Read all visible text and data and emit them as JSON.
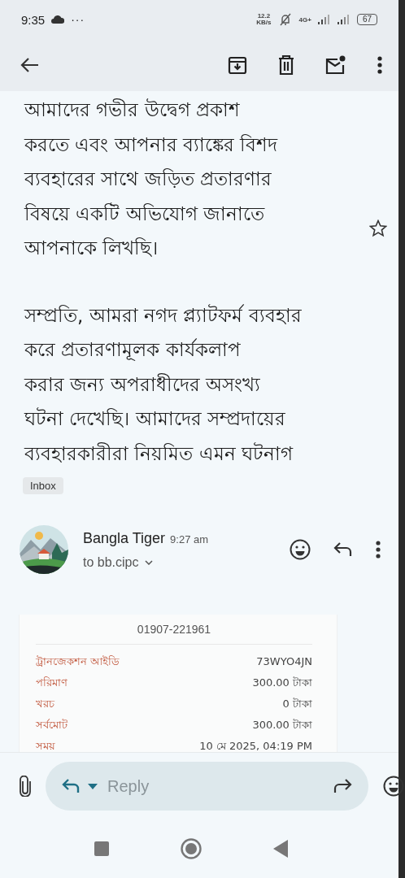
{
  "status_bar": {
    "time": "9:35",
    "more": "···",
    "speed": "12.2",
    "speed_unit": "KB/s",
    "network": "4G+",
    "battery": "67"
  },
  "body": {
    "paragraphs": [
      "আমাদের গভীর উদ্বেগ প্রকাশ\nকরতে এবং আপনার ব্যাঙ্কের বিশদ\nব্যবহারের সাথে জড়িত প্রতারণার\nবিষয়ে একটি অভিযোগ জানাতে\nআপনাকে লিখছি।",
      "সম্প্রতি, আমরা নগদ প্ল্যাটফর্ম ব্যবহার\nকরে প্রতারণামূলক কার্যকলাপ\nকরার জন্য অপরাধীদের অসংখ্য\nঘটনা দেখেছি। আমাদের সম্প্রদায়ের\nব্যবহারকারীরা নিয়মিত এমন ঘটনাগ"
    ],
    "starred": false
  },
  "label": "Inbox",
  "message": {
    "sender": "Bangla Tiger",
    "time": "9:27 am",
    "recipient": "to bb.cipc"
  },
  "receipt": {
    "phone": "01907-221961",
    "rows": [
      {
        "label": "ট্রানজেকশন আইডি",
        "value": "73WYO4JN"
      },
      {
        "label": "পরিমাণ",
        "value": "300.00 টাকা"
      },
      {
        "label": "খরচ",
        "value": "0 টাকা"
      },
      {
        "label": "সর্বমোট",
        "value": "300.00 টাকা"
      },
      {
        "label": "সময়",
        "value": "10 মে 2025, 04:19 PM"
      }
    ]
  },
  "reply": {
    "placeholder": "Reply"
  }
}
